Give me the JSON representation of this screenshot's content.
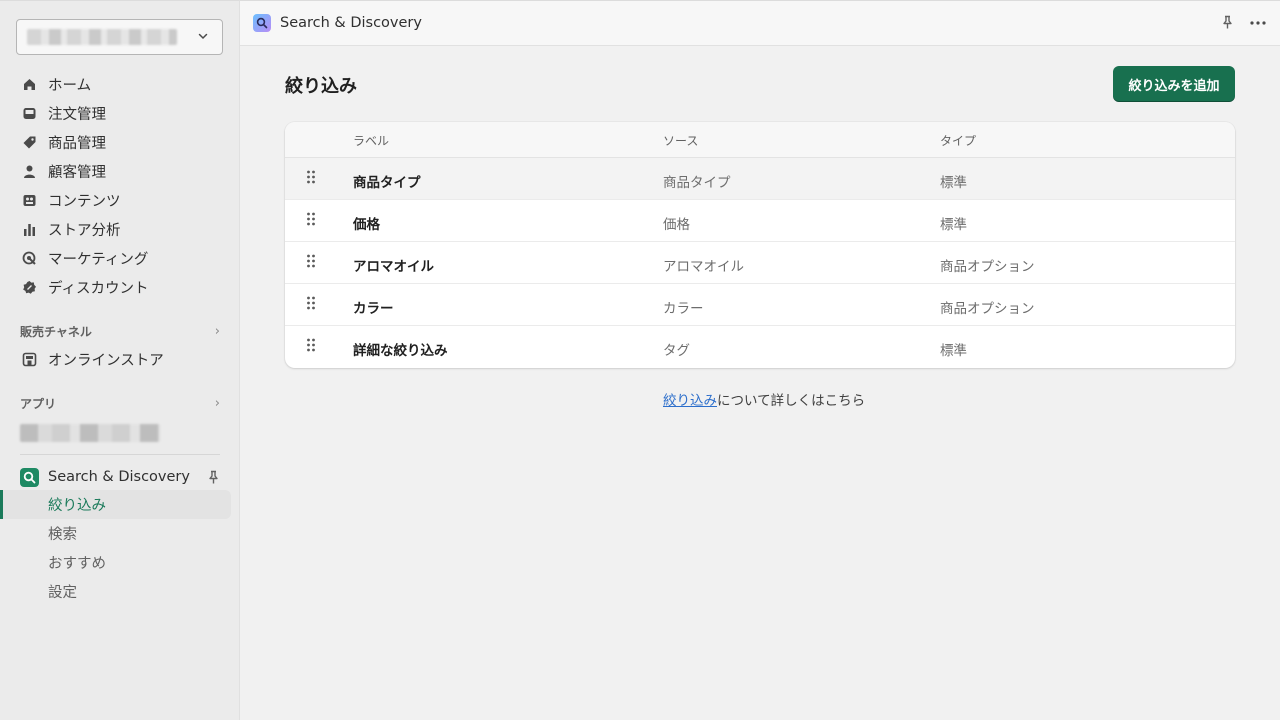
{
  "sidebar": {
    "store_selector": {
      "value_redacted": true
    },
    "nav_items": [
      {
        "id": "home",
        "label": "ホーム",
        "icon": "home-icon"
      },
      {
        "id": "orders",
        "label": "注文管理",
        "icon": "inbox-icon"
      },
      {
        "id": "products",
        "label": "商品管理",
        "icon": "tag-icon"
      },
      {
        "id": "customers",
        "label": "顧客管理",
        "icon": "person-icon"
      },
      {
        "id": "content",
        "label": "コンテンツ",
        "icon": "content-icon"
      },
      {
        "id": "analytics",
        "label": "ストア分析",
        "icon": "bar-chart-icon"
      },
      {
        "id": "marketing",
        "label": "マーケティング",
        "icon": "target-icon"
      },
      {
        "id": "discounts",
        "label": "ディスカウント",
        "icon": "discount-icon"
      }
    ],
    "sales_channels": {
      "heading": "販売チャネル",
      "online_store": "オンラインストア"
    },
    "apps": {
      "heading": "アプリ"
    },
    "app": {
      "name": "Search & Discovery",
      "sub_items": [
        {
          "label": "絞り込み",
          "active": true
        },
        {
          "label": "検索",
          "active": false
        },
        {
          "label": "おすすめ",
          "active": false
        },
        {
          "label": "設定",
          "active": false
        }
      ]
    }
  },
  "topbar": {
    "title": "Search & Discovery"
  },
  "main": {
    "title": "絞り込み",
    "add_button": "絞り込みを追加",
    "table": {
      "headers": {
        "label": "ラベル",
        "source": "ソース",
        "type": "タイプ"
      },
      "rows": [
        {
          "label": "商品タイプ",
          "source": "商品タイプ",
          "type": "標準"
        },
        {
          "label": "価格",
          "source": "価格",
          "type": "標準"
        },
        {
          "label": "アロマオイル",
          "source": "アロマオイル",
          "type": "商品オプション"
        },
        {
          "label": "カラー",
          "source": "カラー",
          "type": "商品オプション"
        },
        {
          "label": "詳細な絞り込み",
          "source": "タグ",
          "type": "標準"
        }
      ]
    },
    "footer": {
      "link": "絞り込み",
      "text": "について詳しくはこちら"
    }
  },
  "colors": {
    "primary": "#18704f",
    "link": "#2c6ecb",
    "active_nav": "#1a7a5a"
  }
}
